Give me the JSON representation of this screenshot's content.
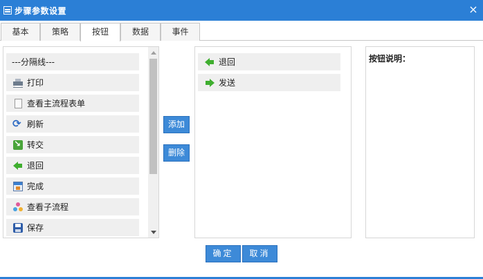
{
  "window": {
    "title": "步骤参数设置",
    "close_glyph": "×"
  },
  "tabs": [
    {
      "label": "基本"
    },
    {
      "label": "策略"
    },
    {
      "label": "按钮",
      "active": true
    },
    {
      "label": "数据"
    },
    {
      "label": "事件"
    }
  ],
  "available_buttons": [
    {
      "label": "---分隔线---",
      "icon": null
    },
    {
      "label": "打印",
      "icon": "printer-icon"
    },
    {
      "label": "查看主流程表单",
      "icon": "document-icon"
    },
    {
      "label": "刷新",
      "icon": "refresh-icon"
    },
    {
      "label": "转交",
      "icon": "transfer-icon"
    },
    {
      "label": "退回",
      "icon": "back-arrow-icon"
    },
    {
      "label": "完成",
      "icon": "complete-icon"
    },
    {
      "label": "查看子流程",
      "icon": "subprocess-icon"
    },
    {
      "label": "保存",
      "icon": "save-icon"
    }
  ],
  "actions": {
    "add_label": "添加",
    "delete_label": "删除"
  },
  "selected_buttons": [
    {
      "label": "退回",
      "icon": "back-arrow-icon"
    },
    {
      "label": "发送",
      "icon": "forward-arrow-icon"
    }
  ],
  "description": {
    "label": "按钮说明："
  },
  "footer": {
    "ok_label": "确定",
    "cancel_label": "取消"
  },
  "colors": {
    "titlebar": "#2b7fd6",
    "button": "#3d8ad8",
    "item_bg": "#efefef"
  }
}
